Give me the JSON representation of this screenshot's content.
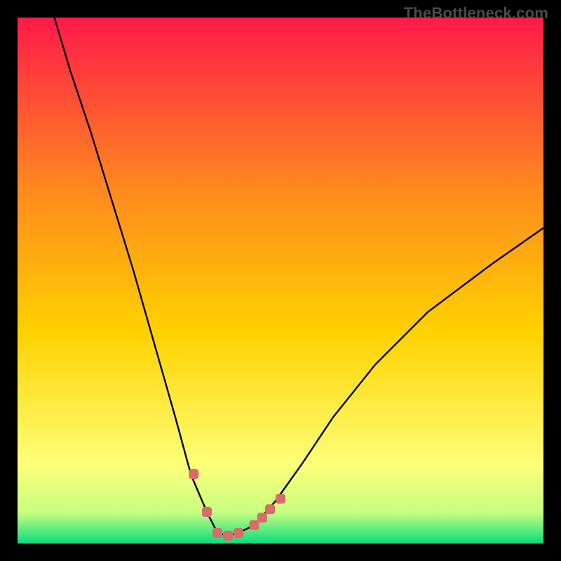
{
  "watermark": "TheBottleneck.com",
  "chart_data": {
    "type": "line",
    "title": "",
    "xlabel": "",
    "ylabel": "",
    "x_range": [
      0,
      1
    ],
    "y_range": [
      0,
      1
    ],
    "series": [
      {
        "name": "bottleneck-curve",
        "x": [
          0.07,
          0.1,
          0.14,
          0.18,
          0.22,
          0.26,
          0.3,
          0.33,
          0.36,
          0.38,
          0.4,
          0.42,
          0.45,
          0.49,
          0.54,
          0.6,
          0.68,
          0.78,
          0.9,
          1.0
        ],
        "y": [
          1.0,
          0.9,
          0.78,
          0.65,
          0.52,
          0.38,
          0.24,
          0.13,
          0.06,
          0.02,
          0.015,
          0.02,
          0.035,
          0.08,
          0.15,
          0.24,
          0.34,
          0.44,
          0.53,
          0.6
        ]
      }
    ],
    "annotations": {
      "minimum_markers_x": [
        0.335,
        0.36,
        0.38,
        0.4,
        0.42,
        0.45,
        0.465,
        0.48,
        0.5
      ],
      "minimum_markers_y": [
        0.132,
        0.06,
        0.02,
        0.015,
        0.02,
        0.035,
        0.049,
        0.065,
        0.085
      ]
    },
    "background_gradient": {
      "top": "#ff1a49",
      "mid": "#ffd200",
      "low": "#feff7a",
      "bottom": "#0bdc7f"
    }
  }
}
